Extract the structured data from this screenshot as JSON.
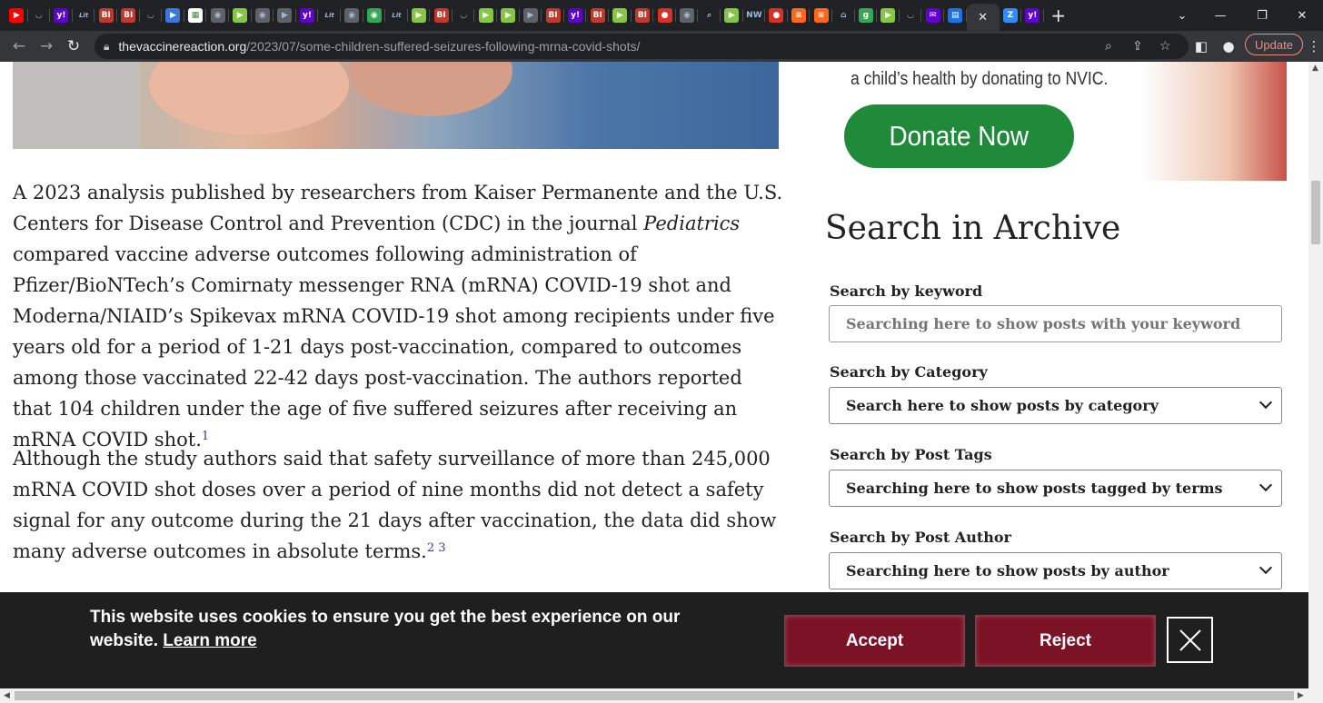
{
  "browser": {
    "active_tab_close": "✕",
    "new_tab": "+",
    "url_domain": "thevaccinereaction.org",
    "url_path": "/2023/07/some-children-suffered-seizures-following-mrna-covid-shots/",
    "update_label": "Update",
    "tabs": [
      {
        "icon": "youtube-icon",
        "color": "#ff0000",
        "glyph": "▶"
      },
      {
        "icon": "shield-icon",
        "color": "#202124",
        "glyph": "◡"
      },
      {
        "icon": "yahoo-icon",
        "color": "#6001d2",
        "glyph": "y!"
      },
      {
        "icon": "lit-icon",
        "color": "#202124",
        "glyph": "Lit"
      },
      {
        "icon": "business-insider-icon",
        "color": "#c0392b",
        "glyph": "BI"
      },
      {
        "icon": "business-insider-icon",
        "color": "#c0392b",
        "glyph": "BI"
      },
      {
        "icon": "shield-icon",
        "color": "#202124",
        "glyph": "◡"
      },
      {
        "icon": "flag-icon",
        "color": "#3c78d8",
        "glyph": "▶"
      },
      {
        "icon": "image-icon",
        "color": "#ffffff",
        "glyph": "▦"
      },
      {
        "icon": "globe-icon",
        "color": "#5f6368",
        "glyph": "◉"
      },
      {
        "icon": "rumble-icon",
        "color": "#85c742",
        "glyph": "▶"
      },
      {
        "icon": "globe-icon",
        "color": "#5f6368",
        "glyph": "◉"
      },
      {
        "icon": "flag-icon",
        "color": "#5f6368",
        "glyph": "▶"
      },
      {
        "icon": "yahoo-icon",
        "color": "#6001d2",
        "glyph": "y!"
      },
      {
        "icon": "lit-icon",
        "color": "#202124",
        "glyph": "Lit"
      },
      {
        "icon": "globe-icon",
        "color": "#5f6368",
        "glyph": "◉"
      },
      {
        "icon": "tripadvisor-icon",
        "color": "#34a853",
        "glyph": "◉"
      },
      {
        "icon": "lit-icon",
        "color": "#202124",
        "glyph": "Lit"
      },
      {
        "icon": "rumble-icon",
        "color": "#85c742",
        "glyph": "▶"
      },
      {
        "icon": "business-insider-icon",
        "color": "#c0392b",
        "glyph": "BI"
      },
      {
        "icon": "shield-icon",
        "color": "#202124",
        "glyph": "◡"
      },
      {
        "icon": "rumble-icon",
        "color": "#85c742",
        "glyph": "▶"
      },
      {
        "icon": "rumble-icon",
        "color": "#85c742",
        "glyph": "▶"
      },
      {
        "icon": "flag-icon",
        "color": "#5f6368",
        "glyph": "▶"
      },
      {
        "icon": "business-insider-icon",
        "color": "#c0392b",
        "glyph": "BI"
      },
      {
        "icon": "yahoo-icon",
        "color": "#6001d2",
        "glyph": "y!"
      },
      {
        "icon": "business-insider-icon",
        "color": "#c0392b",
        "glyph": "BI"
      },
      {
        "icon": "rumble-icon",
        "color": "#85c742",
        "glyph": "▶"
      },
      {
        "icon": "business-insider-icon",
        "color": "#c0392b",
        "glyph": "BI"
      },
      {
        "icon": "podcast-icon",
        "color": "#d93025",
        "glyph": "●"
      },
      {
        "icon": "globe-icon",
        "color": "#5f6368",
        "glyph": "◉"
      },
      {
        "icon": "search-icon",
        "color": "#202124",
        "glyph": "⌕"
      },
      {
        "icon": "rumble-icon",
        "color": "#85c742",
        "glyph": "▶"
      },
      {
        "icon": "news-icon",
        "color": "#202124",
        "glyph": "NW"
      },
      {
        "icon": "podcast-icon",
        "color": "#d93025",
        "glyph": "●"
      },
      {
        "icon": "substack-icon",
        "color": "#ff6719",
        "glyph": "≡"
      },
      {
        "icon": "substack-icon",
        "color": "#ff6719",
        "glyph": "≡"
      },
      {
        "icon": "home-icon",
        "color": "#202124",
        "glyph": "⌂"
      },
      {
        "icon": "goodreads-icon",
        "color": "#34a853",
        "glyph": "g"
      },
      {
        "icon": "rumble-icon",
        "color": "#85c742",
        "glyph": "▶"
      },
      {
        "icon": "shield-icon",
        "color": "#202124",
        "glyph": "◡"
      },
      {
        "icon": "mail-icon",
        "color": "#6001d2",
        "glyph": "✉"
      },
      {
        "icon": "document-icon",
        "color": "#1a73e8",
        "glyph": "▤"
      }
    ],
    "after_active_tabs": [
      {
        "icon": "zoom-icon",
        "color": "#2d8cff",
        "glyph": "Z"
      },
      {
        "icon": "yahoo-icon",
        "color": "#6001d2",
        "glyph": "y!"
      }
    ]
  },
  "article": {
    "p1_part1": "A 2023 analysis published by researchers from Kaiser Permanente and the U.S. Centers for Disease Control and Prevention (CDC) in the journal ",
    "p1_journal": "Pediatrics",
    "p1_part2": " compared vaccine adverse outcomes following administration of Pfizer/BioNTech’s Comirnaty messenger RNA (mRNA) COVID-19 shot and Moderna/NIAID’s Spikevax mRNA COVID-19 shot among recipients under five years old for a period of 1-21 days post-vaccination, compared to outcomes among those vaccinated 22-42 days post-vaccination. The authors reported that 104 children under the age of five suffered seizures after receiving an mRNA COVID shot.",
    "p1_footnote": "1",
    "p2_text": "Although the study authors said that safety surveillance of more than 245,000 mRNA COVID shot doses over a period of nine months did not detect a safety signal for any outcome during the 21 days after vaccination, the data did show many adverse outcomes in absolute terms.",
    "p2_footnotes": "2 3"
  },
  "sidebar": {
    "ad_text": "a child’s health by donating to NVIC.",
    "donate_label": "Donate Now",
    "archive_title": "Search in Archive",
    "keyword_label": "Search by keyword",
    "keyword_placeholder": "Searching here to show posts with your keyword",
    "category_label": "Search by Category",
    "category_value": "Search here to show posts by category",
    "tags_label": "Search by Post Tags",
    "tags_value": "Searching here to show posts tagged by terms",
    "author_label": "Search by Post Author",
    "author_value": "Searching here to show posts by author"
  },
  "cookie": {
    "message": "This website uses cookies to ensure you get the best experience on our website.",
    "learn_more": "Learn more",
    "accept": "Accept",
    "reject": "Reject",
    "accent_color": "#7b1226"
  }
}
